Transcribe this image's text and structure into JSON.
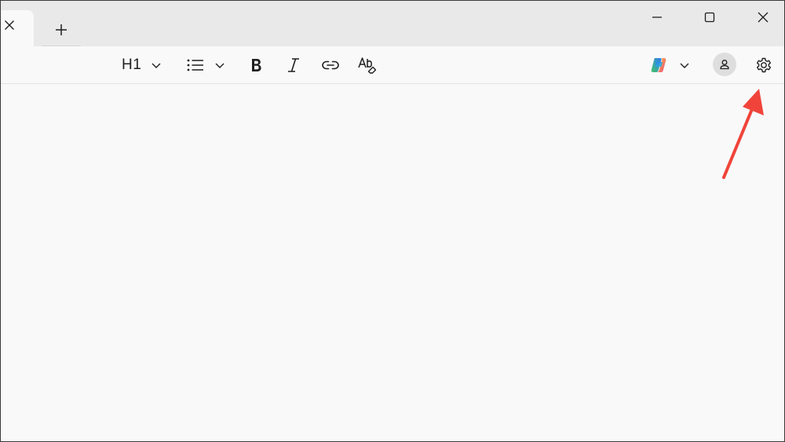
{
  "titlebar": {
    "tab_close_icon": "close-icon",
    "new_tab_icon": "plus-icon",
    "window_controls": {
      "minimize_icon": "minimize-icon",
      "maximize_icon": "maximize-icon",
      "close_icon": "close-icon"
    }
  },
  "toolbar": {
    "heading_style_label": "H1",
    "heading_dropdown_icon": "chevron-down-icon",
    "list_icon": "bulleted-list-icon",
    "list_dropdown_icon": "chevron-down-icon",
    "bold_icon": "bold-icon",
    "italic_icon": "italic-icon",
    "link_icon": "link-icon",
    "clear_format_icon": "clear-formatting-icon",
    "copilot_icon": "copilot-icon",
    "copilot_dropdown_icon": "chevron-down-icon",
    "account_icon": "account-icon",
    "settings_icon": "gear-icon"
  },
  "annotation": {
    "arrow_color": "#f0443a",
    "points_to": "settings-button"
  },
  "colors": {
    "titlebar_bg": "#e9e9e9",
    "editor_bg": "#f9f9f9",
    "icon_color": "#1f1f1f",
    "avatar_bg": "#dedede"
  }
}
